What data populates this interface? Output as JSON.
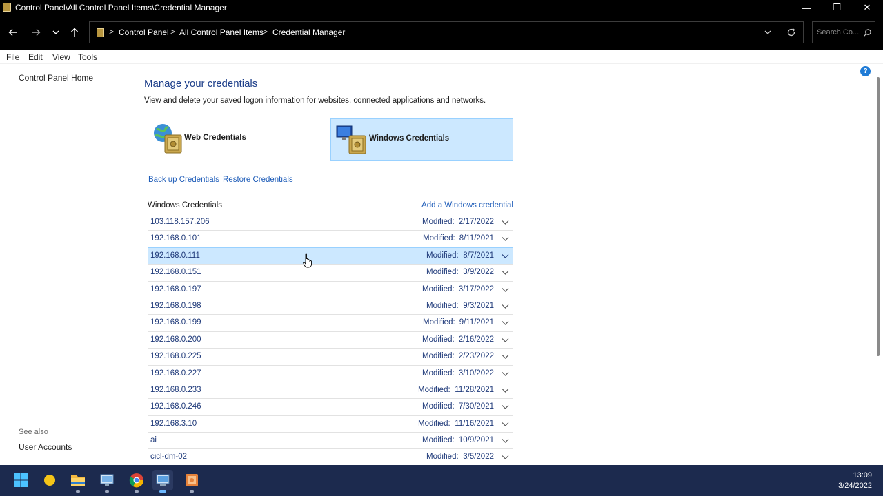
{
  "window": {
    "title": "Control Panel\\All Control Panel Items\\Credential Manager",
    "controls": {
      "minimize": "—",
      "maximize": "❐",
      "close": "✕"
    }
  },
  "addressbar": {
    "crumbs": [
      "Control Panel",
      "All Control Panel Items",
      "Credential Manager"
    ],
    "separator": ">",
    "search_placeholder": "Search Co..."
  },
  "menubar": {
    "items": [
      "File",
      "Edit",
      "View",
      "Tools"
    ]
  },
  "leftpane": {
    "home_link": "Control Panel Home",
    "see_also_label": "See also",
    "see_also_links": [
      "User Accounts"
    ]
  },
  "main": {
    "help_icon_glyph": "?",
    "heading": "Manage your credentials",
    "description": "View and delete your saved logon information for websites, connected applications and networks.",
    "credential_types": {
      "web": "Web Credentials",
      "windows": "Windows Credentials",
      "selected": "windows"
    },
    "actions": {
      "backup": "Back up Credentials",
      "restore": "Restore Credentials"
    },
    "list": {
      "title": "Windows Credentials",
      "add_link": "Add a Windows credential",
      "modified_label": "Modified:",
      "highlighted_index": 2,
      "rows": [
        {
          "name": "103.118.157.206",
          "modified": "2/17/2022"
        },
        {
          "name": "192.168.0.101",
          "modified": "8/11/2021"
        },
        {
          "name": "192.168.0.111",
          "modified": "8/7/2021"
        },
        {
          "name": "192.168.0.151",
          "modified": "3/9/2022"
        },
        {
          "name": "192.168.0.197",
          "modified": "3/17/2022"
        },
        {
          "name": "192.168.0.198",
          "modified": "9/3/2021"
        },
        {
          "name": "192.168.0.199",
          "modified": "9/11/2021"
        },
        {
          "name": "192.168.0.200",
          "modified": "2/16/2022"
        },
        {
          "name": "192.168.0.225",
          "modified": "2/23/2022"
        },
        {
          "name": "192.168.0.227",
          "modified": "3/10/2022"
        },
        {
          "name": "192.168.0.233",
          "modified": "11/28/2021"
        },
        {
          "name": "192.168.0.246",
          "modified": "7/30/2021"
        },
        {
          "name": "192.168.3.10",
          "modified": "11/16/2021"
        },
        {
          "name": "ai",
          "modified": "10/9/2021"
        },
        {
          "name": "cicl-dm-02",
          "modified": "3/5/2022"
        }
      ]
    }
  },
  "taskbar": {
    "apps": [
      "windows-start",
      "weather-widget",
      "file-explorer",
      "remote-desktop",
      "chrome",
      "control-panel",
      "app-orange"
    ],
    "active_app": "control-panel",
    "time": "13:09",
    "date": "3/24/2022"
  },
  "colors": {
    "titlebar_bg": "#000000",
    "selection_bg": "#cce8ff",
    "link": "#1e5cb8",
    "heading": "#1e3f8a",
    "taskbar_bg": "#1c2a4e"
  }
}
